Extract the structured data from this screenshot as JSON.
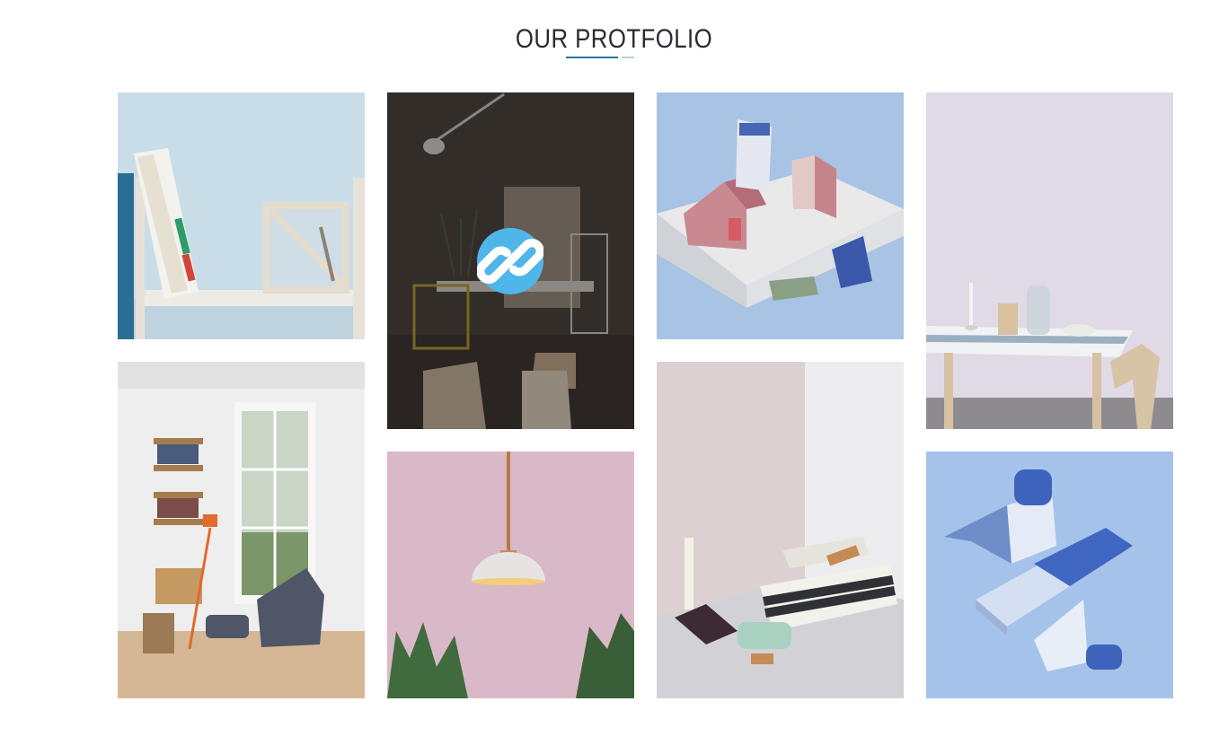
{
  "section": {
    "title": "OUR PROTFOLIO",
    "accent_color": "#2c6fa8"
  },
  "portfolio": {
    "items": [
      {
        "id": "shelf-books",
        "hover": false
      },
      {
        "id": "dark-studio",
        "hover": true,
        "hover_icon": "link-icon",
        "hover_icon_bg": "#4fb6ea"
      },
      {
        "id": "paper-houses",
        "hover": false
      },
      {
        "id": "table-pastel",
        "hover": false
      },
      {
        "id": "reading-room",
        "hover": false
      },
      {
        "id": "pendant-lamp",
        "hover": false
      },
      {
        "id": "candle-books",
        "hover": false
      },
      {
        "id": "paper-blue",
        "hover": false
      }
    ]
  }
}
